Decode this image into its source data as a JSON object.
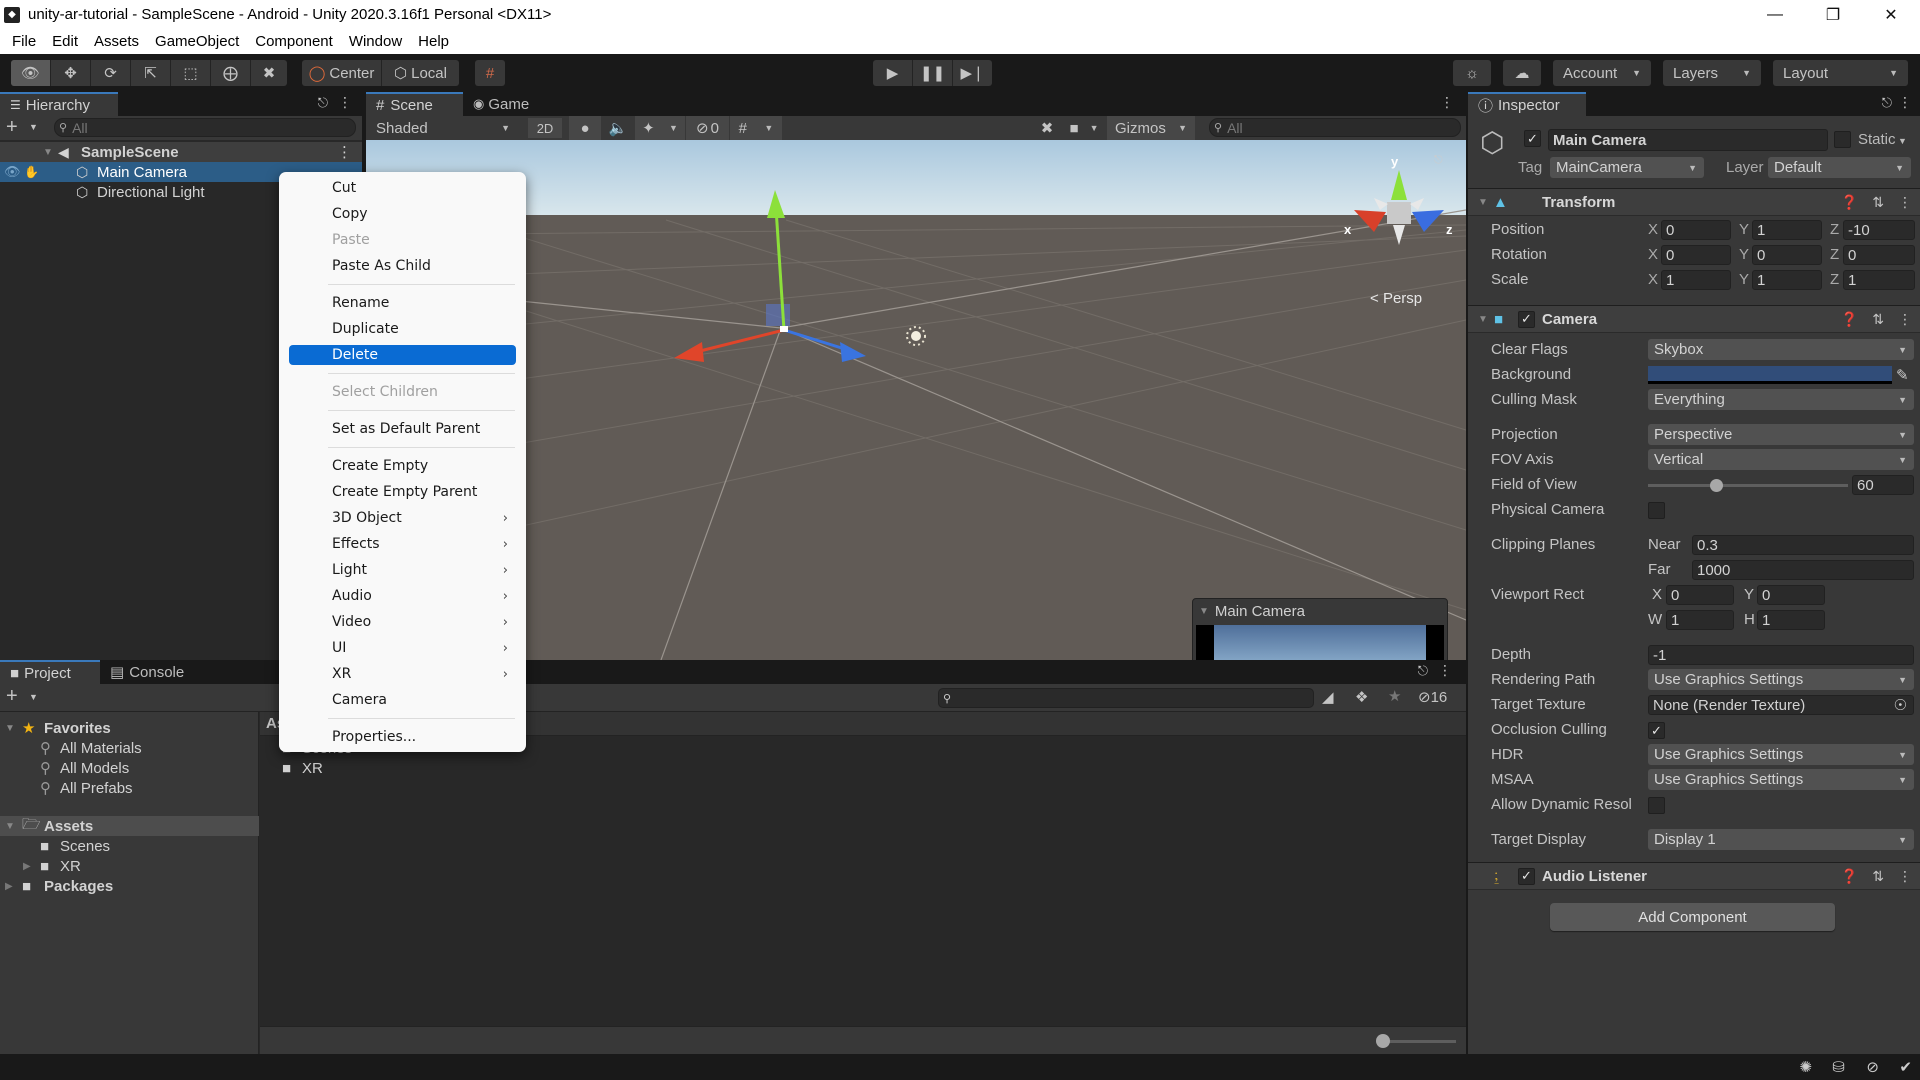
{
  "window": {
    "title": "unity-ar-tutorial - SampleScene - Android - Unity 2020.3.16f1 Personal <DX11>",
    "controls": [
      "minimize",
      "maximize",
      "close"
    ]
  },
  "menubar": [
    "File",
    "Edit",
    "Assets",
    "GameObject",
    "Component",
    "Window",
    "Help"
  ],
  "toolbar": {
    "tools": [
      "view-tool",
      "move-tool",
      "rotate-tool",
      "scale-tool",
      "rect-tool",
      "transform-tool",
      "custom-tool"
    ],
    "pivot_mode": "Center",
    "pivot_rotation": "Local",
    "play_controls": [
      "play",
      "pause",
      "step"
    ],
    "account_label": "Account",
    "layers_label": "Layers",
    "layout_label": "Layout"
  },
  "hierarchy": {
    "tab_label": "Hierarchy",
    "search_placeholder": "All",
    "scene_name": "SampleScene",
    "items": [
      {
        "label": "Main Camera",
        "selected": true
      },
      {
        "label": "Directional Light",
        "selected": false
      }
    ]
  },
  "scene_view": {
    "tabs": [
      {
        "label": "Scene",
        "active": true
      },
      {
        "label": "Game",
        "active": false
      }
    ],
    "shading_mode": "Shaded",
    "mode_2d_label": "2D",
    "hidden_count": "0",
    "gizmos_label": "Gizmos",
    "search_placeholder": "All",
    "persp_label": "Persp",
    "axis_labels": {
      "x": "x",
      "y": "y",
      "z": "z"
    },
    "camera_preview_title": "Main Camera"
  },
  "context_menu": {
    "items": [
      {
        "label": "Cut",
        "state": "normal"
      },
      {
        "label": "Copy",
        "state": "normal"
      },
      {
        "label": "Paste",
        "state": "disabled"
      },
      {
        "label": "Paste As Child",
        "state": "normal"
      },
      {
        "separator": true
      },
      {
        "label": "Rename",
        "state": "normal"
      },
      {
        "label": "Duplicate",
        "state": "normal"
      },
      {
        "label": "Delete",
        "state": "highlighted"
      },
      {
        "separator": true
      },
      {
        "label": "Select Children",
        "state": "disabled"
      },
      {
        "separator": true
      },
      {
        "label": "Set as Default Parent",
        "state": "normal"
      },
      {
        "separator": true
      },
      {
        "label": "Create Empty",
        "state": "normal"
      },
      {
        "label": "Create Empty Parent",
        "state": "normal"
      },
      {
        "label": "3D Object",
        "state": "submenu"
      },
      {
        "label": "Effects",
        "state": "submenu"
      },
      {
        "label": "Light",
        "state": "submenu"
      },
      {
        "label": "Audio",
        "state": "submenu"
      },
      {
        "label": "Video",
        "state": "submenu"
      },
      {
        "label": "UI",
        "state": "submenu"
      },
      {
        "label": "XR",
        "state": "submenu"
      },
      {
        "label": "Camera",
        "state": "normal"
      },
      {
        "separator": true
      },
      {
        "label": "Properties...",
        "state": "normal"
      }
    ]
  },
  "project": {
    "tabs": [
      {
        "label": "Project",
        "active": true
      },
      {
        "label": "Console",
        "active": false
      }
    ],
    "hidden_count": "16",
    "favorites_label": "Favorites",
    "favorites": [
      "All Materials",
      "All Models",
      "All Prefabs"
    ],
    "assets_label": "Assets",
    "assets_children": [
      "Scenes",
      "XR"
    ],
    "packages_label": "Packages",
    "breadcrumb": "Assets",
    "content_items": [
      "Scenes",
      "XR"
    ]
  },
  "inspector": {
    "tab_label": "Inspector",
    "object_name": "Main Camera",
    "object_active": true,
    "static_label": "Static",
    "tag_label": "Tag",
    "tag_value": "MainCamera",
    "layer_label": "Layer",
    "layer_value": "Default",
    "transform": {
      "title": "Transform",
      "rows": [
        {
          "label": "Position",
          "x": "0",
          "y": "1",
          "z": "-10"
        },
        {
          "label": "Rotation",
          "x": "0",
          "y": "0",
          "z": "0"
        },
        {
          "label": "Scale",
          "x": "1",
          "y": "1",
          "z": "1"
        }
      ]
    },
    "camera": {
      "title": "Camera",
      "enabled": true,
      "clear_flags_label": "Clear Flags",
      "clear_flags": "Skybox",
      "background_label": "Background",
      "background_color": "#314d79",
      "culling_mask_label": "Culling Mask",
      "culling_mask": "Everything",
      "projection_label": "Projection",
      "projection": "Perspective",
      "fov_axis_label": "FOV Axis",
      "fov_axis": "Vertical",
      "fov_label": "Field of View",
      "fov": "60",
      "fov_slider_fraction": 0.34,
      "physical_camera_label": "Physical Camera",
      "physical_camera": false,
      "clipping_label": "Clipping Planes",
      "near_label": "Near",
      "near": "0.3",
      "far_label": "Far",
      "far": "1000",
      "viewport_label": "Viewport Rect",
      "viewport": {
        "x": "0",
        "y": "0",
        "w": "1",
        "h": "1"
      },
      "depth_label": "Depth",
      "depth": "-1",
      "rendering_path_label": "Rendering Path",
      "rendering_path": "Use Graphics Settings",
      "target_texture_label": "Target Texture",
      "target_texture": "None (Render Texture)",
      "occlusion_label": "Occlusion Culling",
      "occlusion": true,
      "hdr_label": "HDR",
      "hdr": "Use Graphics Settings",
      "msaa_label": "MSAA",
      "msaa": "Use Graphics Settings",
      "dynamic_res_label": "Allow Dynamic Resol",
      "dynamic_res": false,
      "target_display_label": "Target Display",
      "target_display": "Display 1"
    },
    "audio_listener": {
      "title": "Audio Listener",
      "enabled": true
    },
    "add_component_label": "Add Component"
  },
  "colors": {
    "selection": "#2c5d87",
    "menu_highlight": "#0a6bd3",
    "tab_accent": "#3a79bb"
  }
}
